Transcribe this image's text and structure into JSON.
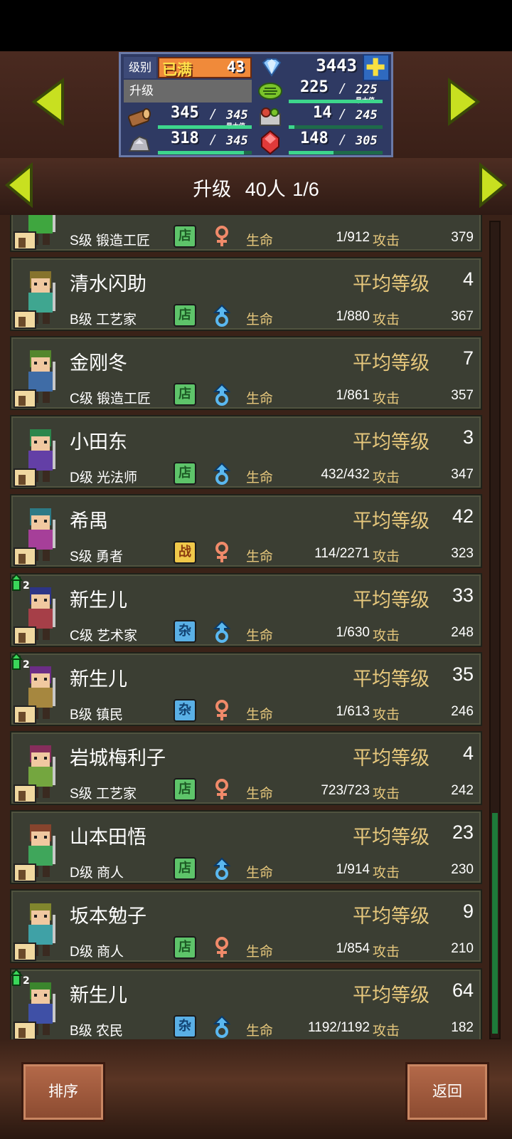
{
  "top": {
    "level_label": "级别",
    "level_status": "已满",
    "level": "43",
    "gems": "3443",
    "upgrade_label": "升级",
    "grass": "225",
    "grass_max": "225",
    "wood": "345",
    "wood_max": "345",
    "food": "14",
    "food_max": "245",
    "ore": "318",
    "ore_max": "345",
    "ruby": "148",
    "ruby_max": "305",
    "max_tag": "最大值"
  },
  "header": {
    "title": "升级",
    "count": "40人",
    "page": "1/6"
  },
  "labels": {
    "avg_level": "平均等级",
    "hp": "生命",
    "atk": "攻击"
  },
  "rows": [
    {
      "name": "",
      "avg": "",
      "rank": "S级 锻造工匠",
      "cat": "店",
      "gender": "female",
      "hp": "1/912",
      "atk": "379"
    },
    {
      "name": "清水闪助",
      "avg": "4",
      "rank": "B级 工艺家",
      "cat": "店",
      "gender": "male",
      "hp": "1/880",
      "atk": "367"
    },
    {
      "name": "金刚冬",
      "avg": "7",
      "rank": "C级 锻造工匠",
      "cat": "店",
      "gender": "male",
      "hp": "1/861",
      "atk": "357"
    },
    {
      "name": "小田东",
      "avg": "3",
      "rank": "D级 光法师",
      "cat": "店",
      "gender": "male",
      "hp": "432/432",
      "atk": "347"
    },
    {
      "name": "希禺",
      "avg": "42",
      "rank": "S级 勇者",
      "cat": "战",
      "gender": "female",
      "hp": "114/2271",
      "atk": "323"
    },
    {
      "name": "新生儿",
      "avg": "33",
      "rank": "C级 艺术家",
      "cat": "杂",
      "gender": "male",
      "hp": "1/630",
      "atk": "248",
      "promo": "2"
    },
    {
      "name": "新生儿",
      "avg": "35",
      "rank": "B级 镇民",
      "cat": "杂",
      "gender": "female",
      "hp": "1/613",
      "atk": "246",
      "promo": "2"
    },
    {
      "name": "岩城梅利子",
      "avg": "4",
      "rank": "S级 工艺家",
      "cat": "店",
      "gender": "female",
      "hp": "723/723",
      "atk": "242"
    },
    {
      "name": "山本田悟",
      "avg": "23",
      "rank": "D级 商人",
      "cat": "店",
      "gender": "male",
      "hp": "1/914",
      "atk": "230"
    },
    {
      "name": "坂本勉子",
      "avg": "9",
      "rank": "D级 商人",
      "cat": "店",
      "gender": "female",
      "hp": "1/854",
      "atk": "210"
    },
    {
      "name": "新生儿",
      "avg": "64",
      "rank": "B级 农民",
      "cat": "杂",
      "gender": "male",
      "hp": "1192/1192",
      "atk": "182",
      "promo": "2"
    }
  ],
  "buttons": {
    "sort": "排序",
    "back": "返回"
  },
  "colors": {
    "accent_yellow": "#c8e020",
    "panel_blue": "#2f3a63",
    "row_bg": "#3b3e33"
  }
}
